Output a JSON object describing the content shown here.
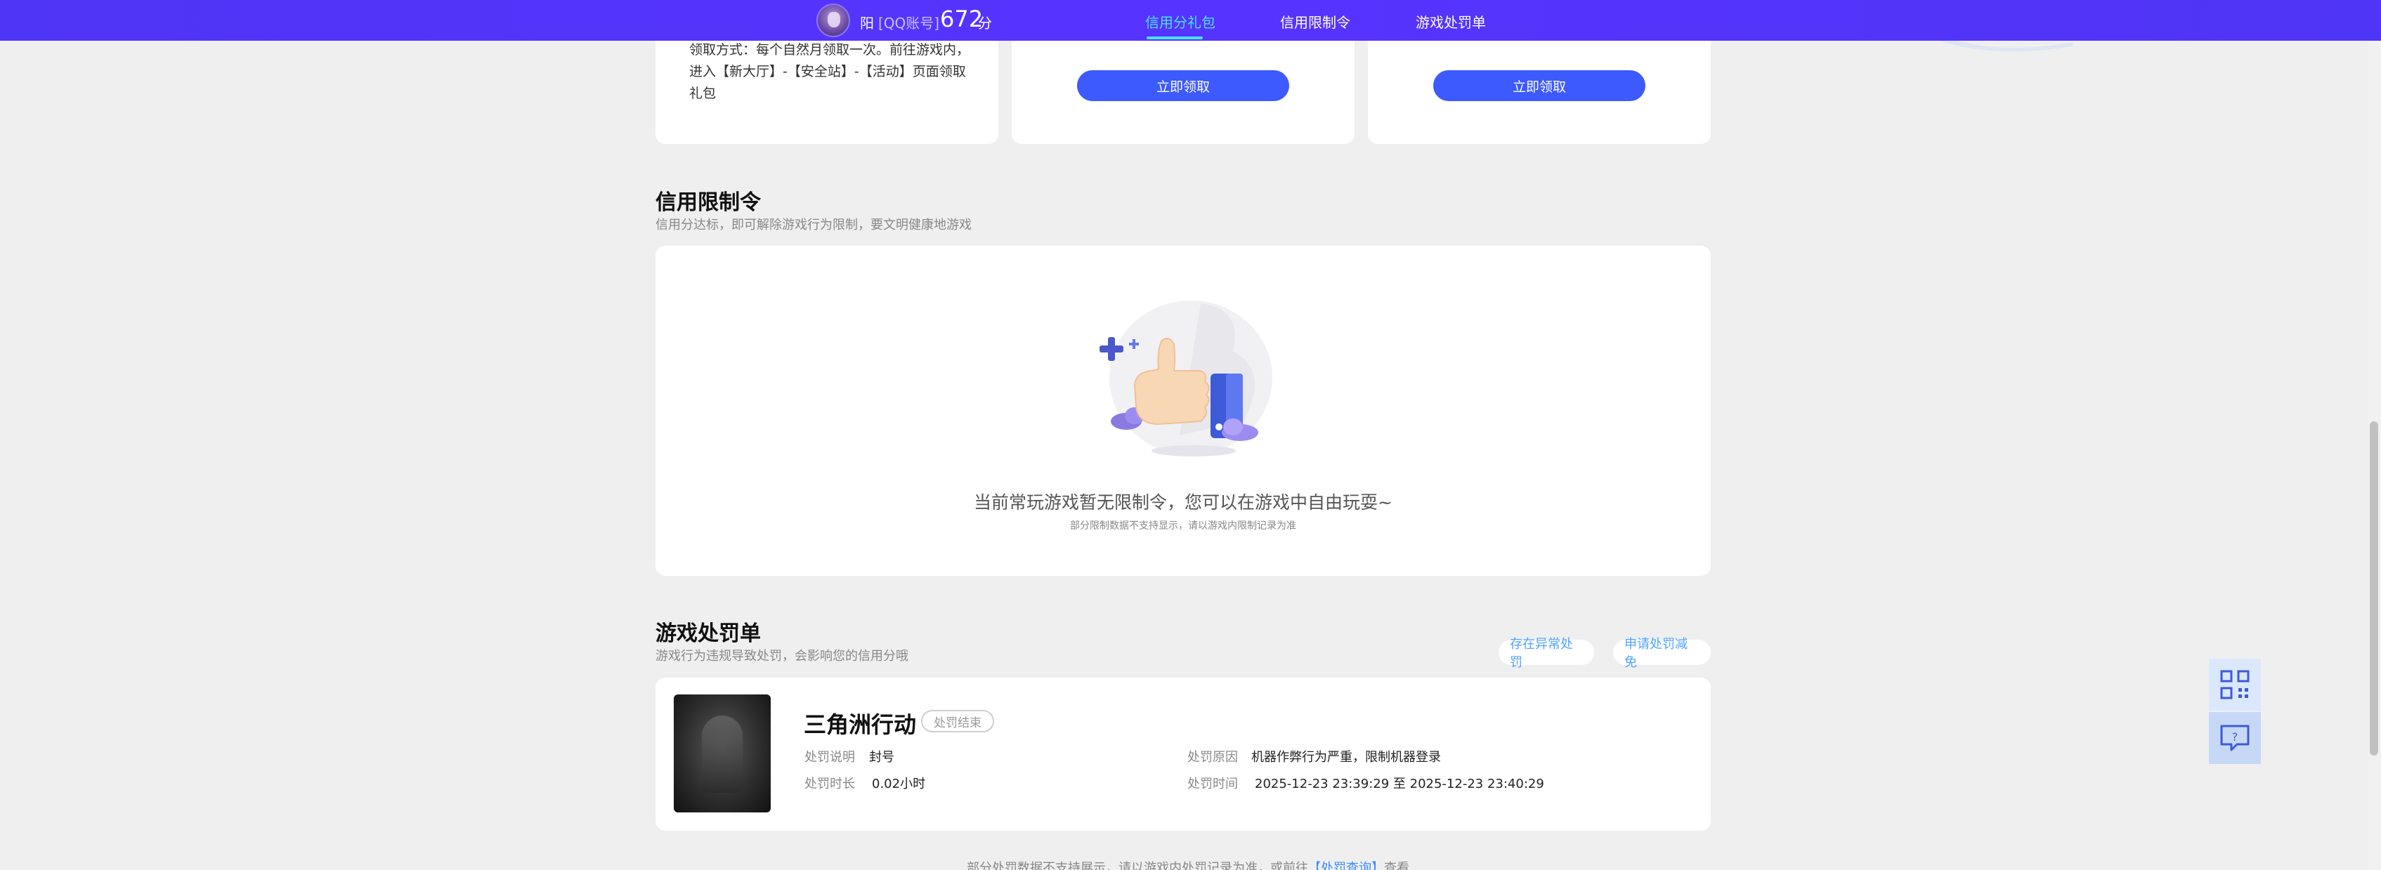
{
  "header": {
    "user_name": "阳",
    "account_type": "[QQ账号]",
    "score": "672",
    "score_unit": "分",
    "tabs": [
      {
        "label": "信用分礼包",
        "active": true
      },
      {
        "label": "信用限制令",
        "active": false
      },
      {
        "label": "游戏处罚单",
        "active": false
      }
    ]
  },
  "gift": {
    "card1_text": "领取方式：每个自然月领取一次。前往游戏内，进入【新大厅】-【安全站】-【活动】页面领取礼包",
    "claim_label": "立即领取"
  },
  "restriction": {
    "title": "信用限制令",
    "subtitle": "信用分达标，即可解除游戏行为限制，要文明健康地游戏",
    "empty_message": "当前常玩游戏暂无限制令，您可以在游戏中自由玩耍~",
    "empty_note": "部分限制数据不支持显示，请以游戏内限制记录为准"
  },
  "penalty": {
    "title": "游戏处罚单",
    "subtitle": "游戏行为违规导致处罚，会影响您的信用分哦",
    "abnormal_btn": "存在异常处罚",
    "appeal_btn": "申请处罚减免",
    "game_name": "三角洲行动",
    "status": "处罚结束",
    "desc_label": "处罚说明",
    "desc_value": "封号",
    "duration_label": "处罚时长",
    "duration_value": "0.02小时",
    "reason_label": "处罚原因",
    "reason_value": "机器作弊行为严重，限制机器登录",
    "time_label": "处罚时间",
    "time_value": "2025-12-23 23:39:29 至 2025-12-23 23:40:29"
  },
  "footer": {
    "note_prefix": "部分处罚数据不支持展示，请以游戏内处罚记录为准，或前往",
    "link_text": "【处罚查询】",
    "note_suffix": "查看"
  },
  "colors": {
    "nav_bg": "#5432ff",
    "accent_blue": "#3d5afe",
    "active_tab": "#49e3ff"
  },
  "icons": {
    "qr": "qr-code-icon",
    "feedback": "feedback-icon"
  }
}
